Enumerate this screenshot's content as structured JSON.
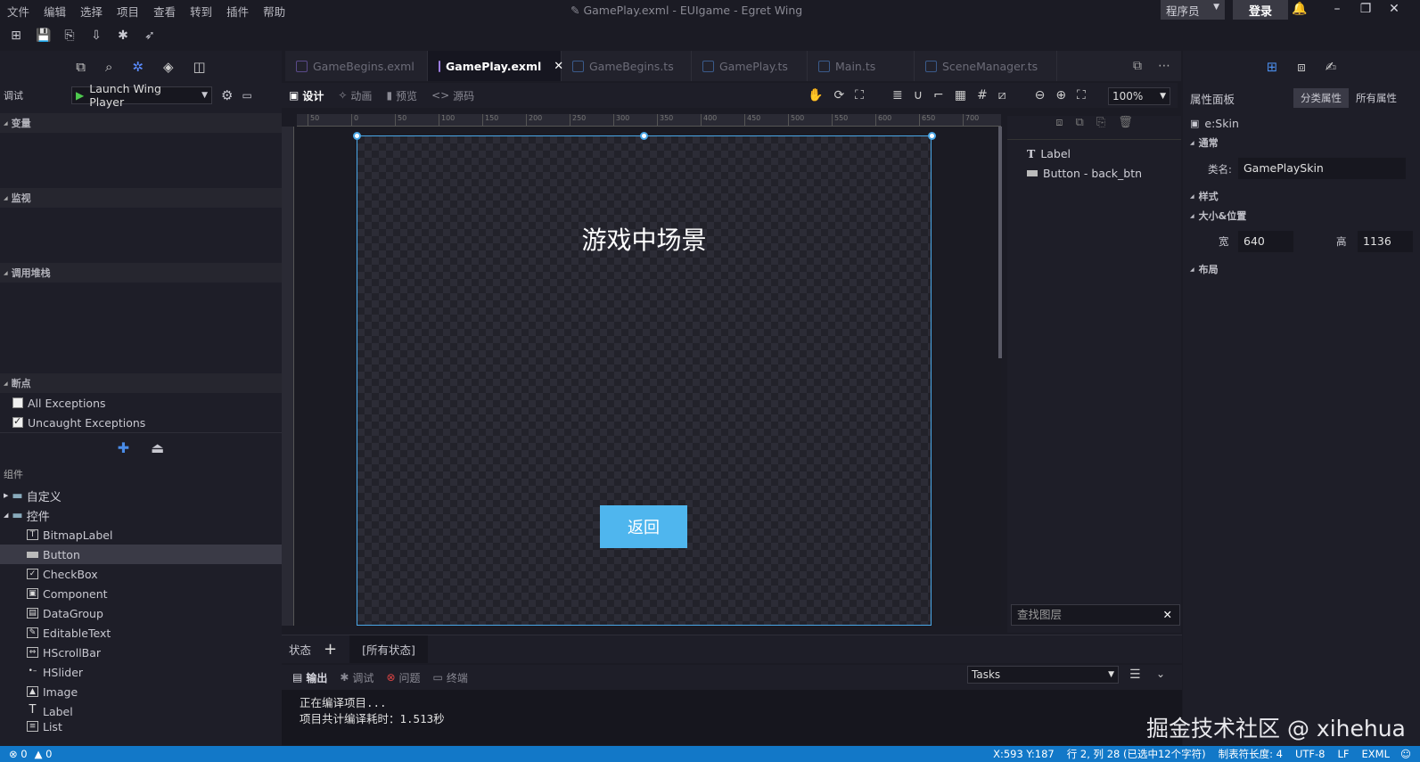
{
  "menu": [
    "文件",
    "编辑",
    "选择",
    "项目",
    "查看",
    "转到",
    "插件",
    "帮助"
  ],
  "window_title": "GamePlay.exml - EUIgame - Egret Wing",
  "role": "程序员",
  "login": "登录",
  "tabs": [
    {
      "label": "GameBegins.exml",
      "active": false
    },
    {
      "label": "GamePlay.exml",
      "active": true
    },
    {
      "label": "GameBegins.ts",
      "active": false
    },
    {
      "label": "GamePlay.ts",
      "active": false
    },
    {
      "label": "Main.ts",
      "active": false
    },
    {
      "label": "SceneManager.ts",
      "active": false
    }
  ],
  "left": {
    "debug_label": "调试",
    "launch": "Launch Wing Player",
    "sections": {
      "variables": "变量",
      "watch": "监视",
      "callstack": "调用堆栈",
      "breakpoints": "断点"
    },
    "all_exceptions": "All Exceptions",
    "uncaught_exceptions": "Uncaught Exceptions",
    "components_label": "组件",
    "folder_custom": "自定义",
    "folder_controls": "控件",
    "components": [
      "BitmapLabel",
      "Button",
      "CheckBox",
      "Component",
      "DataGroup",
      "EditableText",
      "HScrollBar",
      "HSlider",
      "Image",
      "Label",
      "List"
    ]
  },
  "design": {
    "tab_design": "设计",
    "tab_anim": "动画",
    "tab_preview": "预览",
    "tab_source": "源码",
    "zoom": "100%"
  },
  "ruler_ticks": [
    "50",
    "0",
    "50",
    "100",
    "150",
    "200",
    "250",
    "300",
    "350",
    "400",
    "450",
    "500",
    "550",
    "600",
    "650",
    "700"
  ],
  "stage": {
    "title": "游戏中场景",
    "back_button": "返回"
  },
  "layers": {
    "items": [
      "Label",
      "Button - back_btn"
    ],
    "search_placeholder": "查找图层"
  },
  "states": {
    "label": "状态",
    "add": "+",
    "all": "[所有状态]"
  },
  "output": {
    "tabs": [
      "输出",
      "调试",
      "问题",
      "终端"
    ],
    "tasks": "Tasks",
    "lines": [
      "正在编译项目...",
      "项目共计编译耗时：1.513秒"
    ]
  },
  "properties": {
    "title": "属性面板",
    "tab_category": "分类属性",
    "tab_all": "所有属性",
    "skin": "e:Skin",
    "general": "通常",
    "class_label": "类名:",
    "class_value": "GamePlaySkin",
    "style": "样式",
    "size_pos": "大小&位置",
    "width_label": "宽",
    "width_value": "640",
    "height_label": "高",
    "height_value": "1136",
    "layout": "布局"
  },
  "status": {
    "errors": "0",
    "warnings": "0",
    "coords": "X:593 Y:187",
    "cursor": "行 2, 列 28 (已选中12个字符)",
    "tab_size": "制表符长度: 4",
    "encoding": "UTF-8",
    "eol": "LF",
    "lang": "EXML"
  },
  "watermark": "掘金技术社区 @ xihehua"
}
